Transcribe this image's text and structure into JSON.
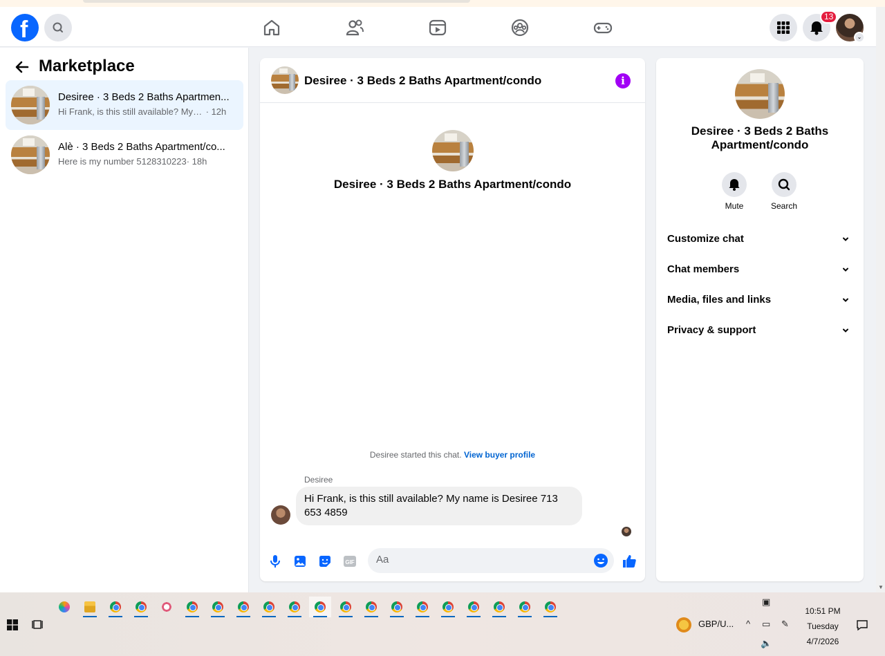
{
  "topnav": {
    "logo": "f",
    "notification_count": "13"
  },
  "left": {
    "title": "Marketplace",
    "conversations": [
      {
        "title": "Desiree · 3 Beds 2 Baths Apartmen...",
        "message": "Hi Frank, is this still available? My na...",
        "time": "· 12h"
      },
      {
        "title": "Alè · 3 Beds 2 Baths Apartment/co...",
        "message": "Here is my number 5128310223",
        "time": "· 18h"
      }
    ]
  },
  "chat": {
    "header_title": "Desiree · 3 Beds 2 Baths Apartment/condo",
    "center_title": "Desiree · 3 Beds 2 Baths Apartment/condo",
    "started_text": "Desiree started this chat.",
    "view_profile": "View buyer profile",
    "sender": "Desiree",
    "message": "Hi Frank, is this still available? My name is Desiree 713 653 4859",
    "input_placeholder": "Aa",
    "gif_label": "GIF"
  },
  "right": {
    "title": "Desiree · 3 Beds 2 Baths Apartment/condo",
    "actions": [
      {
        "label": "Mute"
      },
      {
        "label": "Search"
      }
    ],
    "rows": [
      {
        "label": "Customize chat"
      },
      {
        "label": "Chat members"
      },
      {
        "label": "Media, files and links"
      },
      {
        "label": "Privacy & support"
      }
    ]
  },
  "taskbar": {
    "currency": "GBP/U...",
    "time": "10:51 PM",
    "day": "Tuesday",
    "date": "4/7/2026"
  },
  "colors": {
    "brand": "#0866ff",
    "accent_purple": "#a100f5",
    "active_row": "#ebf5ff",
    "badge": "#e41e3f"
  }
}
